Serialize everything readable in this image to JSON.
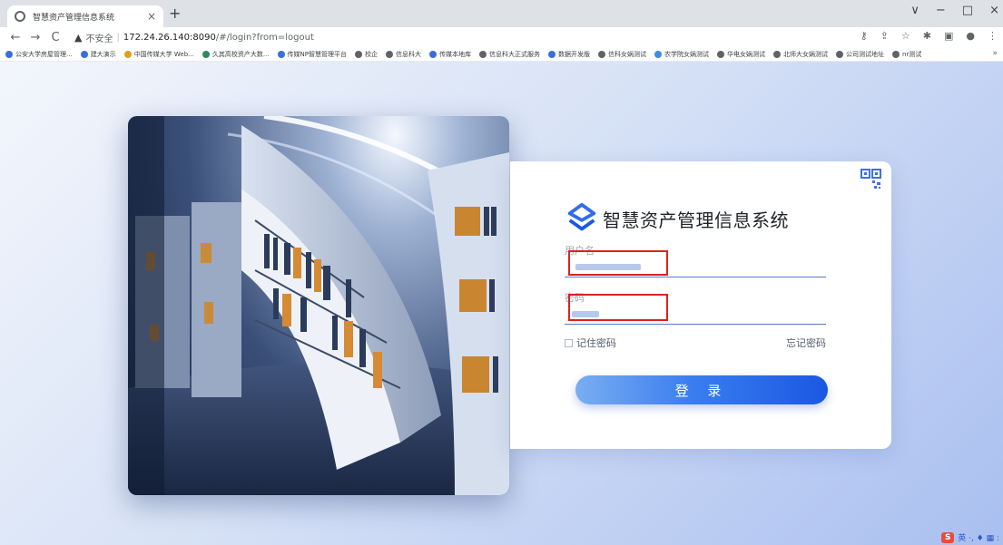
{
  "browser": {
    "tab_title": "智慧资产管理信息系统",
    "tab_close": "×",
    "new_tab": "+",
    "window_controls": [
      "∨",
      "−",
      "□",
      "×"
    ],
    "nav": {
      "back": "←",
      "forward": "→",
      "reload": "C"
    },
    "address": {
      "warning_icon": "▲",
      "insecure_label": "不安全",
      "separator": "|",
      "host": "172.24.26.140:8090",
      "path": "/#/login?from=logout"
    },
    "toolbar_icons": [
      "key-icon",
      "share-icon",
      "star-icon",
      "extensions-icon",
      "sidebar-icon",
      "profile-icon",
      "menu-icon"
    ],
    "bookmarks": [
      {
        "label": "公安大学房屋管理...",
        "color": "#3b6fd8"
      },
      {
        "label": "建大演示",
        "color": "#3b6fd8"
      },
      {
        "label": "中国传媒大学 Web...",
        "color": "#e0a020"
      },
      {
        "label": "久其高校资产大数...",
        "color": "#2e8b57"
      },
      {
        "label": "传媒NP智慧管理平台",
        "color": "#3b6fd8"
      },
      {
        "label": "校企",
        "color": "#5f6368"
      },
      {
        "label": "信息科大",
        "color": "#5f6368"
      },
      {
        "label": "传媒本地库",
        "color": "#3b6fd8"
      },
      {
        "label": "信息科大正式服务",
        "color": "#5f6368"
      },
      {
        "label": "数据开发版",
        "color": "#3b6fd8"
      },
      {
        "label": "信科女娲测试",
        "color": "#5f6368"
      },
      {
        "label": "农学院女娲测试",
        "color": "#3b8fe0"
      },
      {
        "label": "华电女娲测试",
        "color": "#5f6368"
      },
      {
        "label": "北师大女娲测试",
        "color": "#5f6368"
      },
      {
        "label": "公司测试地址",
        "color": "#5f6368"
      },
      {
        "label": "nr测试",
        "color": "#5f6368"
      }
    ],
    "bookmarks_overflow": "»"
  },
  "login": {
    "system_title": "智慧资产管理信息系统",
    "username_label": "用户名",
    "username_value": "",
    "password_label": "密码",
    "password_value": "",
    "remember_label": "记住密码",
    "remember_checked": false,
    "forgot_label": "忘记密码",
    "submit_label": "登 录"
  },
  "taskbar": {
    "ime_logo": "S",
    "ime_text": "英 ·, ♦ ▦ :"
  },
  "colors": {
    "accent": "#2f6ee8",
    "highlight_box": "#e02020",
    "background_gradient_end": "#a9bff0"
  }
}
